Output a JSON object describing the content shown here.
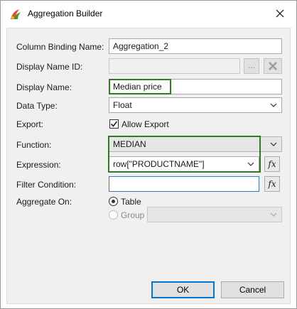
{
  "window": {
    "title": "Aggregation Builder",
    "icon": "birt-app-icon",
    "close_icon": "close-icon"
  },
  "form": {
    "column_binding_name": {
      "label": "Column Binding Name:",
      "value": "Aggregation_2"
    },
    "display_name_id": {
      "label": "Display Name ID:",
      "value": "",
      "browse_label": "...",
      "clear_icon": "clear-x-icon"
    },
    "display_name": {
      "label": "Display Name:",
      "value": "Median price"
    },
    "data_type": {
      "label": "Data Type:",
      "value": "Float"
    },
    "export": {
      "label": "Export:",
      "checkbox_label": "Allow Export",
      "checked": true
    },
    "function": {
      "label": "Function:",
      "value": "MEDIAN"
    },
    "expression": {
      "label": "Expression:",
      "value": "row[\"PRODUCTNAME\"]",
      "fx_label": "fx"
    },
    "filter_condition": {
      "label": "Filter Condition:",
      "value": "",
      "fx_label": "fx"
    },
    "aggregate_on": {
      "label": "Aggregate On:",
      "options": [
        {
          "label": "Table",
          "selected": true,
          "enabled": true
        },
        {
          "label": "Group",
          "selected": false,
          "enabled": false
        }
      ],
      "group_value": ""
    }
  },
  "buttons": {
    "ok": "OK",
    "cancel": "Cancel"
  },
  "colors": {
    "highlight": "#2f7d21",
    "default_button_border": "#0078d7",
    "dialog_bg": "#f0f0f0"
  }
}
